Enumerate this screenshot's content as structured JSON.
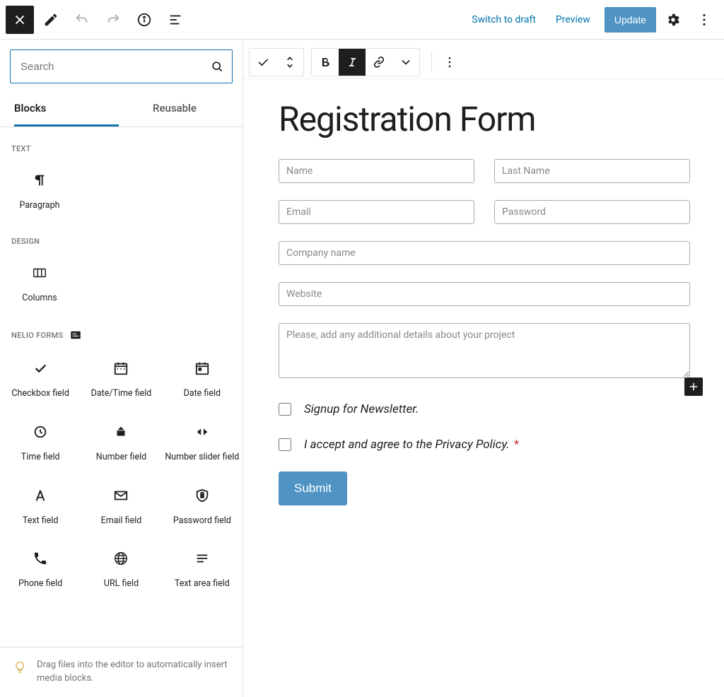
{
  "topbar": {
    "switch_draft": "Switch to draft",
    "preview": "Preview",
    "update": "Update"
  },
  "sidebar": {
    "search_placeholder": "Search",
    "tabs": {
      "blocks": "Blocks",
      "reusable": "Reusable"
    },
    "sections": {
      "text": "TEXT",
      "design": "DESIGN",
      "forms": "NELIO FORMS"
    },
    "blocks": {
      "paragraph": "Paragraph",
      "columns": "Columns",
      "checkbox": "Checkbox field",
      "datetime": "Date/Time field",
      "date": "Date field",
      "time": "Time field",
      "number": "Number field",
      "number_slider": "Number slider field",
      "text": "Text field",
      "email": "Email field",
      "password": "Password field",
      "phone": "Phone field",
      "url": "URL field",
      "textarea": "Text area field"
    },
    "hint": "Drag files into the editor to automatically insert media blocks."
  },
  "editor": {
    "title": "Registration Form",
    "fields": {
      "name": "Name",
      "lastname": "Last Name",
      "email": "Email",
      "password": "Password",
      "company": "Company name",
      "website": "Website",
      "details": "Please, add any additional details about your project"
    },
    "checks": {
      "newsletter": "Signup for Newsletter.",
      "privacy": "I accept and agree to the Privacy Policy."
    },
    "submit": "Submit"
  }
}
